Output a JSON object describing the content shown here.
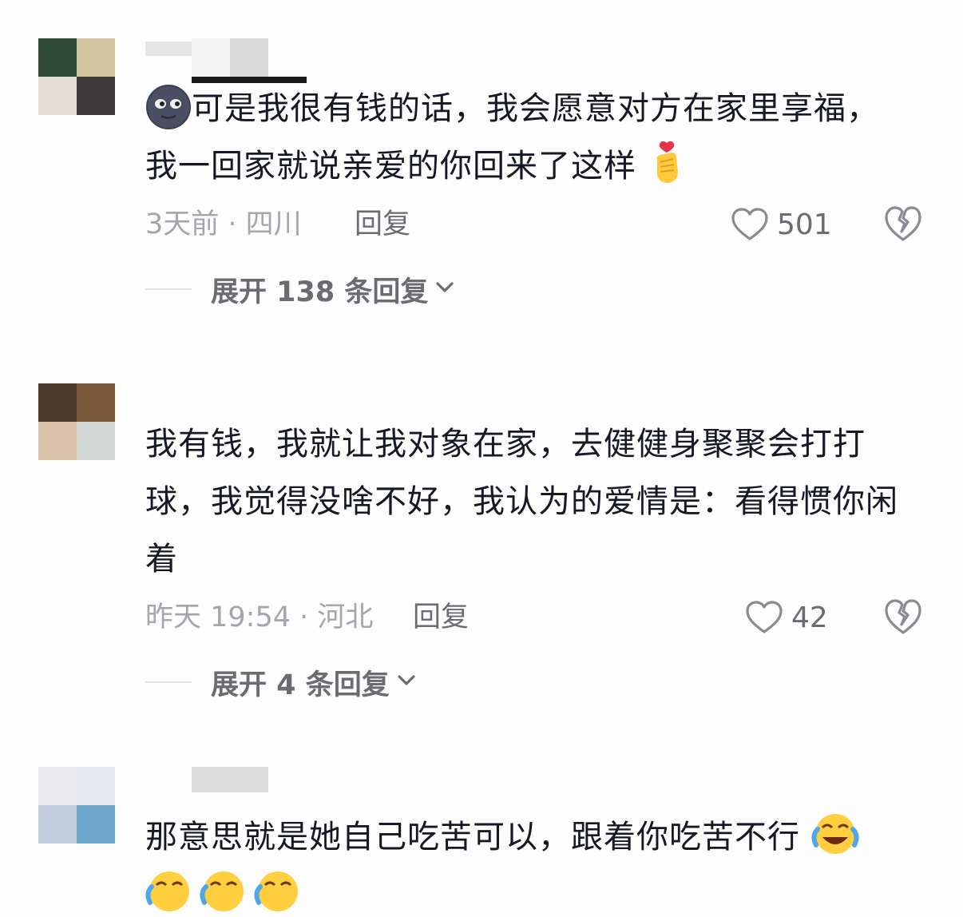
{
  "comments": [
    {
      "text": "可是我很有钱的话，我会愿意对方在家里享福，我一回家就说亲爱的你回来了这样",
      "lead_emoji": "new-moon-face-emoji",
      "trail_emoji": "heart-hands-emoji",
      "time_location": "3天前 · 四川",
      "reply_label": "回复",
      "like_count": "501",
      "expand_label": "展开 138 条回复"
    },
    {
      "text": "我有钱，我就让我对象在家，去健健身聚聚会打打球，我觉得没啥不好，我认为的爱情是：看得惯你闲着",
      "time_location": "昨天 19:54 · 河北",
      "reply_label": "回复",
      "like_count": "42",
      "expand_label": "展开 4 条回复"
    },
    {
      "text": "那意思就是她自己吃苦可以，跟着你吃苦不行",
      "trail_emoji": "face-with-tears-of-joy-emoji"
    }
  ]
}
